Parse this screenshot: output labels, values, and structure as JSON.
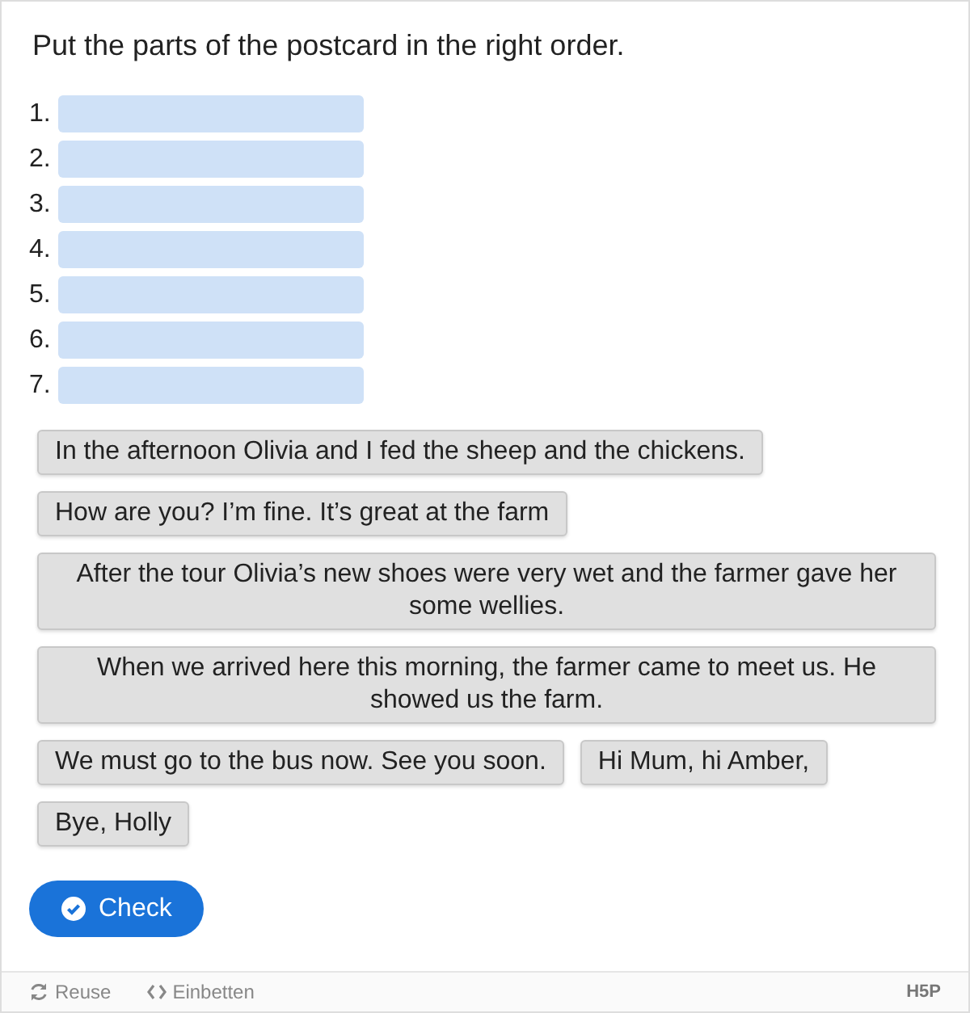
{
  "task": "Put the parts of the postcard in the right order.",
  "dropzones": [
    {
      "number": "1."
    },
    {
      "number": "2."
    },
    {
      "number": "3."
    },
    {
      "number": "4."
    },
    {
      "number": "5."
    },
    {
      "number": "6."
    },
    {
      "number": "7."
    }
  ],
  "parts": [
    "In the afternoon Olivia and I fed the sheep and the chickens.",
    "How are you? I’m fine. It’s great at the farm",
    "After the tour Olivia’s new shoes were very wet and the farmer gave her some wellies.",
    "When we arrived here this morning, the farmer came to meet us. He showed us the farm.",
    "We must go to the bus now. See you soon.",
    "Hi Mum, hi Amber,",
    "Bye, Holly"
  ],
  "check_button": "Check",
  "footer": {
    "reuse": "Reuse",
    "embed": "Einbetten",
    "logo": "H5P"
  }
}
